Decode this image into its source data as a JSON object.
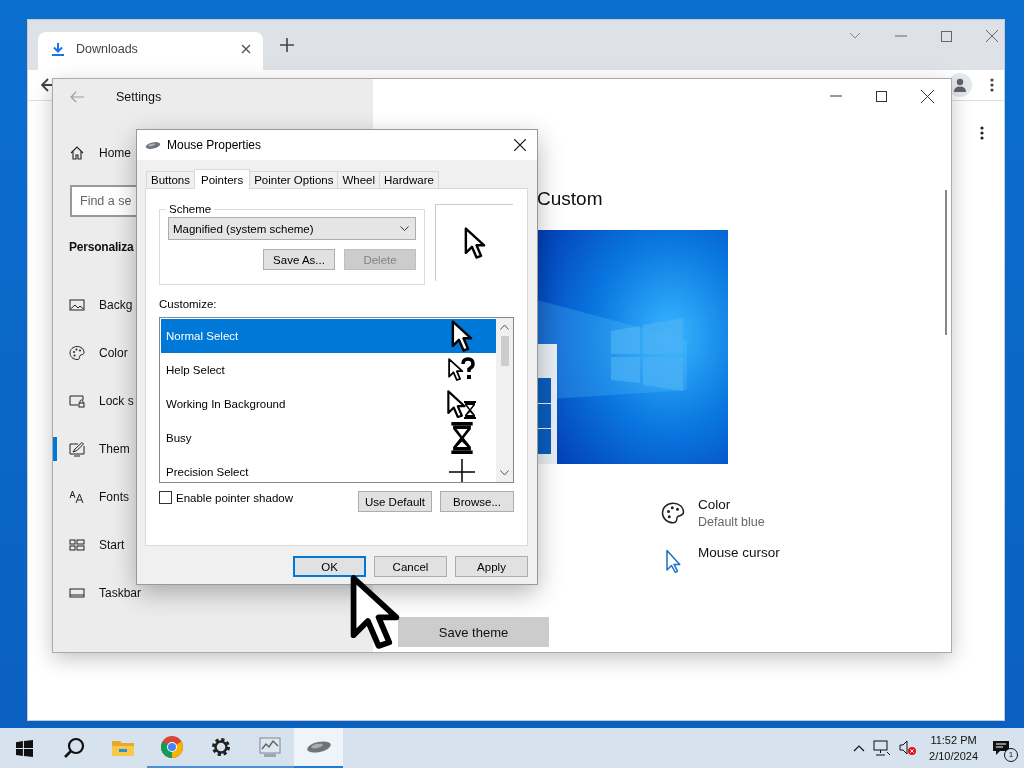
{
  "browser": {
    "tab": {
      "title": "Downloads"
    }
  },
  "settings": {
    "title": "Settings",
    "home": {
      "label": "Home"
    },
    "search": {
      "placeholder": "Find a se"
    },
    "section": "Personaliza",
    "items": [
      {
        "label": "Backg",
        "kind": "picture",
        "selected": false
      },
      {
        "label": "Color",
        "kind": "palette",
        "selected": false
      },
      {
        "label": "Lock s",
        "kind": "lock",
        "selected": false
      },
      {
        "label": "Them",
        "kind": "theme",
        "selected": true
      },
      {
        "label": "Fonts",
        "kind": "fonts",
        "selected": false
      },
      {
        "label": "Start",
        "kind": "start",
        "selected": false
      },
      {
        "label": "Taskbar",
        "kind": "taskbar",
        "selected": false
      }
    ],
    "theme": {
      "heading": "Custom",
      "options": [
        {
          "kind": "palette",
          "label": "Color",
          "detail": "Default blue"
        },
        {
          "kind": "pointer",
          "label": "Mouse cursor"
        }
      ],
      "save_button": "Save theme"
    }
  },
  "dialog": {
    "title": "Mouse Properties",
    "tabs": [
      {
        "label": "Buttons",
        "selected": false
      },
      {
        "label": "Pointers",
        "selected": true
      },
      {
        "label": "Pointer Options",
        "selected": false
      },
      {
        "label": "Wheel",
        "selected": false
      },
      {
        "label": "Hardware",
        "selected": false
      }
    ],
    "scheme": {
      "legend": "Scheme",
      "value": "Magnified (system scheme)",
      "buttons": [
        {
          "label": "Save As...",
          "disabled": false
        },
        {
          "label": "Delete",
          "disabled": true
        }
      ]
    },
    "customize_label": "Customize:",
    "pointers": [
      {
        "label": "Normal Select",
        "kind": "arrow",
        "selected": true
      },
      {
        "label": "Help Select",
        "kind": "help",
        "selected": false
      },
      {
        "label": "Working In Background",
        "kind": "working",
        "selected": false
      },
      {
        "label": "Busy",
        "kind": "busy",
        "selected": false
      },
      {
        "label": "Precision Select",
        "kind": "cross",
        "selected": false
      }
    ],
    "shadow": {
      "label": "Enable pointer shadow",
      "checked": false
    },
    "list_buttons": [
      "Use Default",
      "Browse..."
    ],
    "footer_buttons": [
      {
        "label": "OK",
        "default": true
      },
      {
        "label": "Cancel",
        "default": false
      },
      {
        "label": "Apply",
        "default": false
      }
    ]
  },
  "taskbar": {
    "apps": [
      {
        "kind": "start",
        "running": false,
        "selected": false
      },
      {
        "kind": "search",
        "running": false,
        "selected": false
      },
      {
        "kind": "explorer",
        "running": false,
        "selected": false
      },
      {
        "kind": "chrome",
        "running": true,
        "selected": false
      },
      {
        "kind": "settings",
        "running": true,
        "selected": false
      },
      {
        "kind": "monitor",
        "running": true,
        "selected": false
      },
      {
        "kind": "mouse",
        "running": true,
        "selected": true
      }
    ],
    "clock": {
      "time": "11:52 PM",
      "date": "2/10/2024"
    },
    "notifications": "1"
  }
}
